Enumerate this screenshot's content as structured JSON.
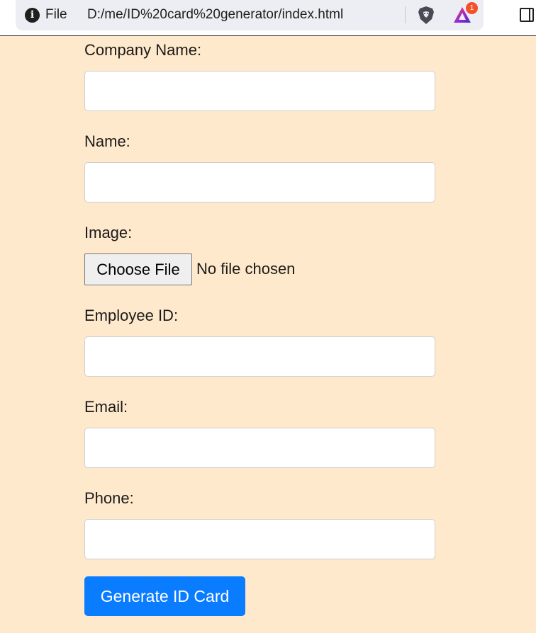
{
  "browser": {
    "scheme_label": "File",
    "url": "D:/me/ID%20card%20generator/index.html",
    "rewards_badge": "1",
    "info_icon": "info-icon",
    "shield_icon": "brave-shield-icon",
    "rewards_icon": "brave-rewards-icon",
    "sidepanel_icon": "sidebar-toggle-icon"
  },
  "form": {
    "company_label": "Company Name:",
    "company_value": "",
    "name_label": "Name:",
    "name_value": "",
    "image_label": "Image:",
    "choose_file_label": "Choose File",
    "file_status": "No file chosen",
    "employee_id_label": "Employee ID:",
    "employee_id_value": "",
    "email_label": "Email:",
    "email_value": "",
    "phone_label": "Phone:",
    "phone_value": "",
    "submit_label": "Generate ID Card"
  },
  "colors": {
    "page_background": "#ffe9cc",
    "button_primary": "#0a7cff",
    "badge": "#f3502b"
  }
}
